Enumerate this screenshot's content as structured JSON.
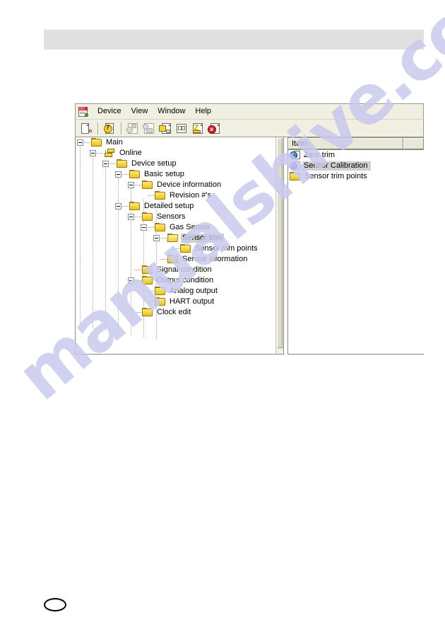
{
  "page": {
    "header_bar": "",
    "footer_marker": "page-number-oval",
    "watermark": "manualshive.com"
  },
  "window": {
    "menu": {
      "app_icon": "dd-document-icon",
      "items": [
        {
          "label": "Device",
          "name": "menu-device"
        },
        {
          "label": "View",
          "name": "menu-view"
        },
        {
          "label": "Window",
          "name": "menu-window"
        },
        {
          "label": "Help",
          "name": "menu-help"
        }
      ]
    },
    "toolbar": {
      "buttons": [
        {
          "name": "new-document-icon",
          "enabled": true
        },
        {
          "name": "help-about-icon",
          "enabled": true
        },
        {
          "name": "device-scan-icon",
          "enabled": false
        },
        {
          "name": "device-config-icon",
          "enabled": false
        },
        {
          "name": "send-to-device-icon",
          "enabled": true
        },
        {
          "name": "compare-document-icon",
          "enabled": true
        },
        {
          "name": "flash-document-icon",
          "enabled": true
        },
        {
          "name": "disconnect-device-icon",
          "enabled": true
        }
      ]
    },
    "tree": {
      "name": "device-navigation-tree",
      "nodes": [
        {
          "label": "Main",
          "depth": 0,
          "icon": "folder",
          "expander": "minus",
          "selected": false
        },
        {
          "label": "Online",
          "depth": 1,
          "icon": "device",
          "expander": "minus",
          "selected": false
        },
        {
          "label": "Device setup",
          "depth": 2,
          "icon": "folder",
          "expander": "minus",
          "selected": false
        },
        {
          "label": "Basic setup",
          "depth": 3,
          "icon": "folder",
          "expander": "minus",
          "selected": false
        },
        {
          "label": "Device information",
          "depth": 4,
          "icon": "folder",
          "expander": "minus",
          "selected": false
        },
        {
          "label": "Revision #'s",
          "depth": 5,
          "icon": "folder",
          "expander": "leaf",
          "selected": false
        },
        {
          "label": "Detailed setup",
          "depth": 3,
          "icon": "folder",
          "expander": "minus",
          "selected": false
        },
        {
          "label": "Sensors",
          "depth": 4,
          "icon": "folder",
          "expander": "minus",
          "selected": false
        },
        {
          "label": "Gas Sensor",
          "depth": 5,
          "icon": "folder",
          "expander": "minus",
          "selected": false
        },
        {
          "label": "Sensor trim",
          "depth": 6,
          "icon": "folder-open",
          "expander": "minus",
          "selected": true
        },
        {
          "label": "Sensor trim points",
          "depth": 7,
          "icon": "folder",
          "expander": "leaf",
          "selected": false
        },
        {
          "label": "Sensor information",
          "depth": 6,
          "icon": "folder",
          "expander": "leaf",
          "selected": false
        },
        {
          "label": "Signal condition",
          "depth": 4,
          "icon": "folder",
          "expander": "leaf",
          "selected": false
        },
        {
          "label": "Output condition",
          "depth": 4,
          "icon": "folder",
          "expander": "minus",
          "selected": false
        },
        {
          "label": "Analog output",
          "depth": 5,
          "icon": "folder",
          "expander": "leaf",
          "selected": false
        },
        {
          "label": "HART output",
          "depth": 5,
          "icon": "folder",
          "expander": "leaf",
          "selected": false
        },
        {
          "label": "Clock edit",
          "depth": 4,
          "icon": "folder",
          "expander": "leaf",
          "selected": false
        }
      ]
    },
    "list": {
      "name": "item-list-panel",
      "columns": [
        {
          "label": "Item",
          "name": "column-item"
        },
        {
          "label": "",
          "name": "column-blank"
        }
      ],
      "rows": [
        {
          "label": "Zero trim",
          "icon": "method",
          "selected": false
        },
        {
          "label": "Sensor Calibration",
          "icon": "method",
          "selected": true
        },
        {
          "label": "Sensor trim points",
          "icon": "folder",
          "selected": false
        }
      ]
    }
  },
  "colors": {
    "folder_yellow": "#f5d33a",
    "selection_gray": "#d0d0d0",
    "chrome": "#f1efe2",
    "watermark": "#c9c9ee",
    "header_bar": "#e0e0e0"
  }
}
